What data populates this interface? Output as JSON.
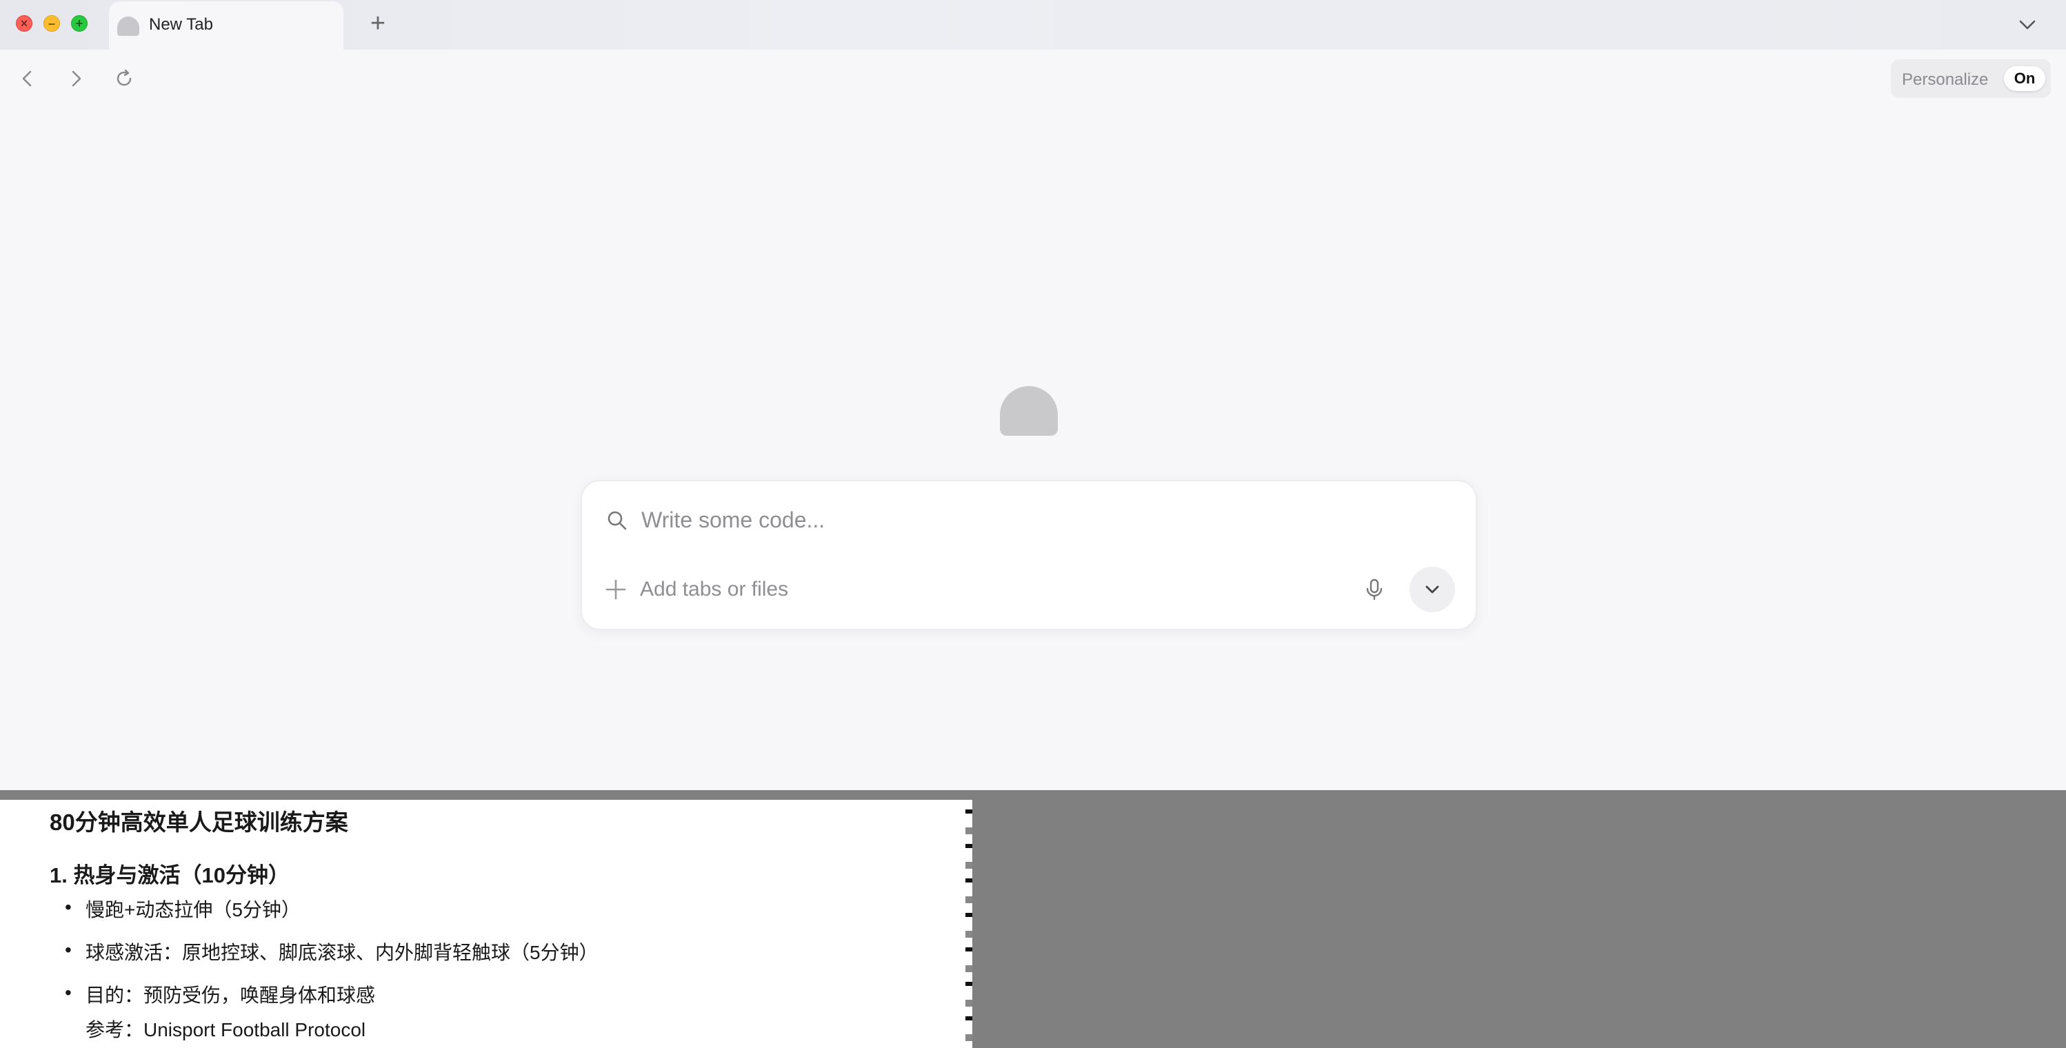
{
  "window": {
    "tab_title": "New Tab",
    "new_tab_symbol": "+"
  },
  "toolbar": {
    "personalize_label": "Personalize",
    "personalize_state": "On"
  },
  "composer": {
    "placeholder": "Write some code...",
    "attach_label": "Add tabs or files"
  },
  "document": {
    "title": "80分钟高效单人足球训练方案",
    "section_title": "1. 热身与激活（10分钟）",
    "bullets": [
      "慢跑+动态拉伸（5分钟）",
      "球感激活：原地控球、脚底滚球、内外脚背轻触球（5分钟）",
      "目的：预防受伤，唤醒身体和球感"
    ],
    "reference": "参考：Unisport Football Protocol"
  },
  "colors": {
    "close": "#ff5f57",
    "minimize": "#febc2e",
    "zoom": "#28c840",
    "overlay_grey": "#808080"
  },
  "icons": {
    "back": "chevron-left-icon",
    "forward": "chevron-right-icon",
    "reload": "reload-icon",
    "search": "search-icon",
    "plus": "plus-icon",
    "mic": "microphone-icon",
    "expand": "chevron-down-icon"
  }
}
